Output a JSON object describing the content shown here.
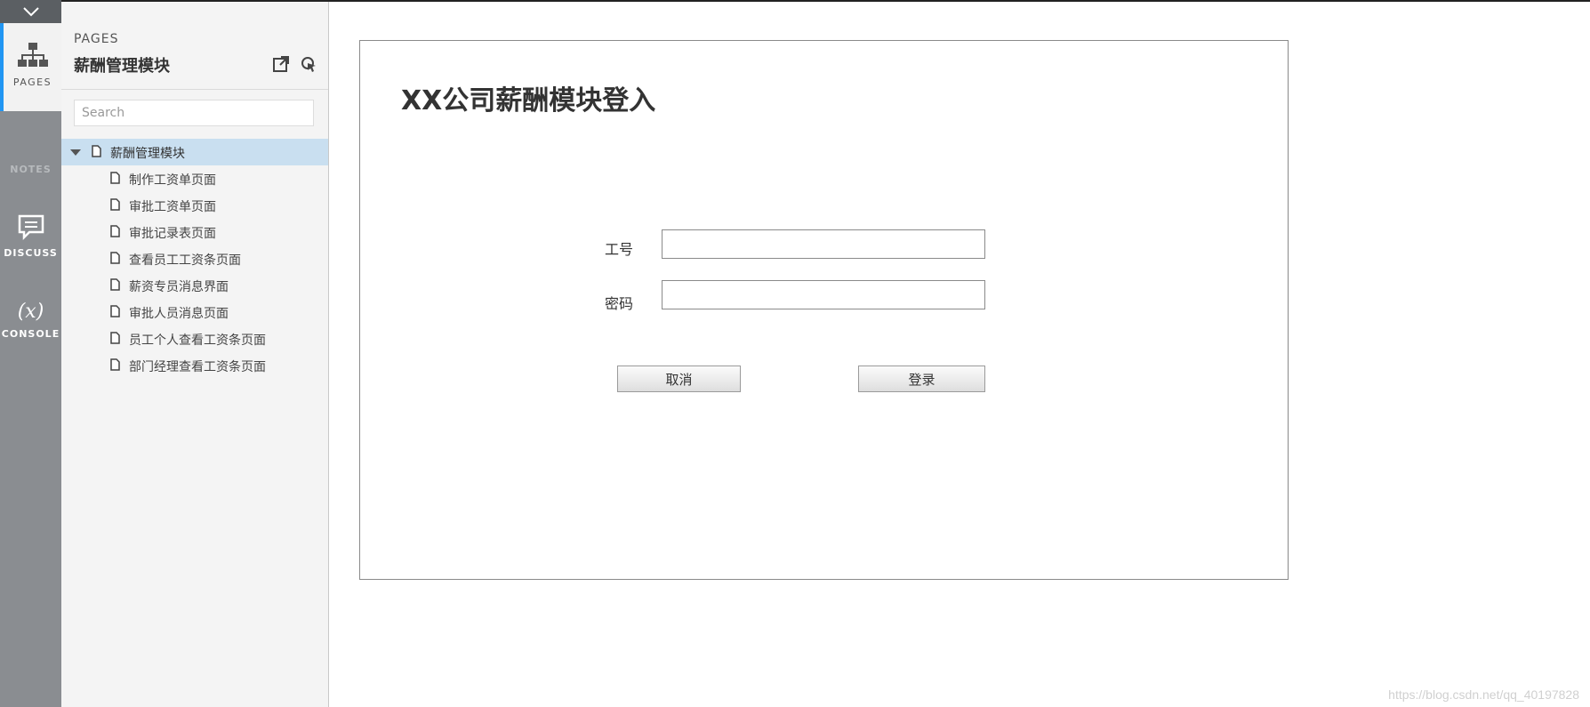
{
  "sidebar": {
    "pages_label": "PAGES",
    "notes_label": "NOTES",
    "discuss_label": "DISCUSS",
    "console_label": "CONSOLE",
    "console_symbol": "(x)"
  },
  "panel": {
    "heading": "PAGES",
    "title": "薪酬管理模块",
    "search_placeholder": "Search",
    "tree": {
      "root": "薪酬管理模块",
      "children": [
        "制作工资单页面",
        "审批工资单页面",
        "审批记录表页面",
        "查看员工工资条页面",
        "薪资专员消息界面",
        "审批人员消息页面",
        "员工个人查看工资条页面",
        "部门经理查看工资条页面"
      ]
    }
  },
  "board": {
    "title": "XX公司薪酬模块登入",
    "employee_id_label": "工号",
    "password_label": "密码",
    "employee_id_value": "",
    "password_value": "",
    "cancel_label": "取消",
    "login_label": "登录"
  },
  "watermark": "https://blog.csdn.net/qq_40197828",
  "colors": {
    "rail_bg": "#8a8d91",
    "active_accent": "#2196f3",
    "selected_row": "#c9dff0",
    "panel_bg": "#f4f4f4"
  }
}
